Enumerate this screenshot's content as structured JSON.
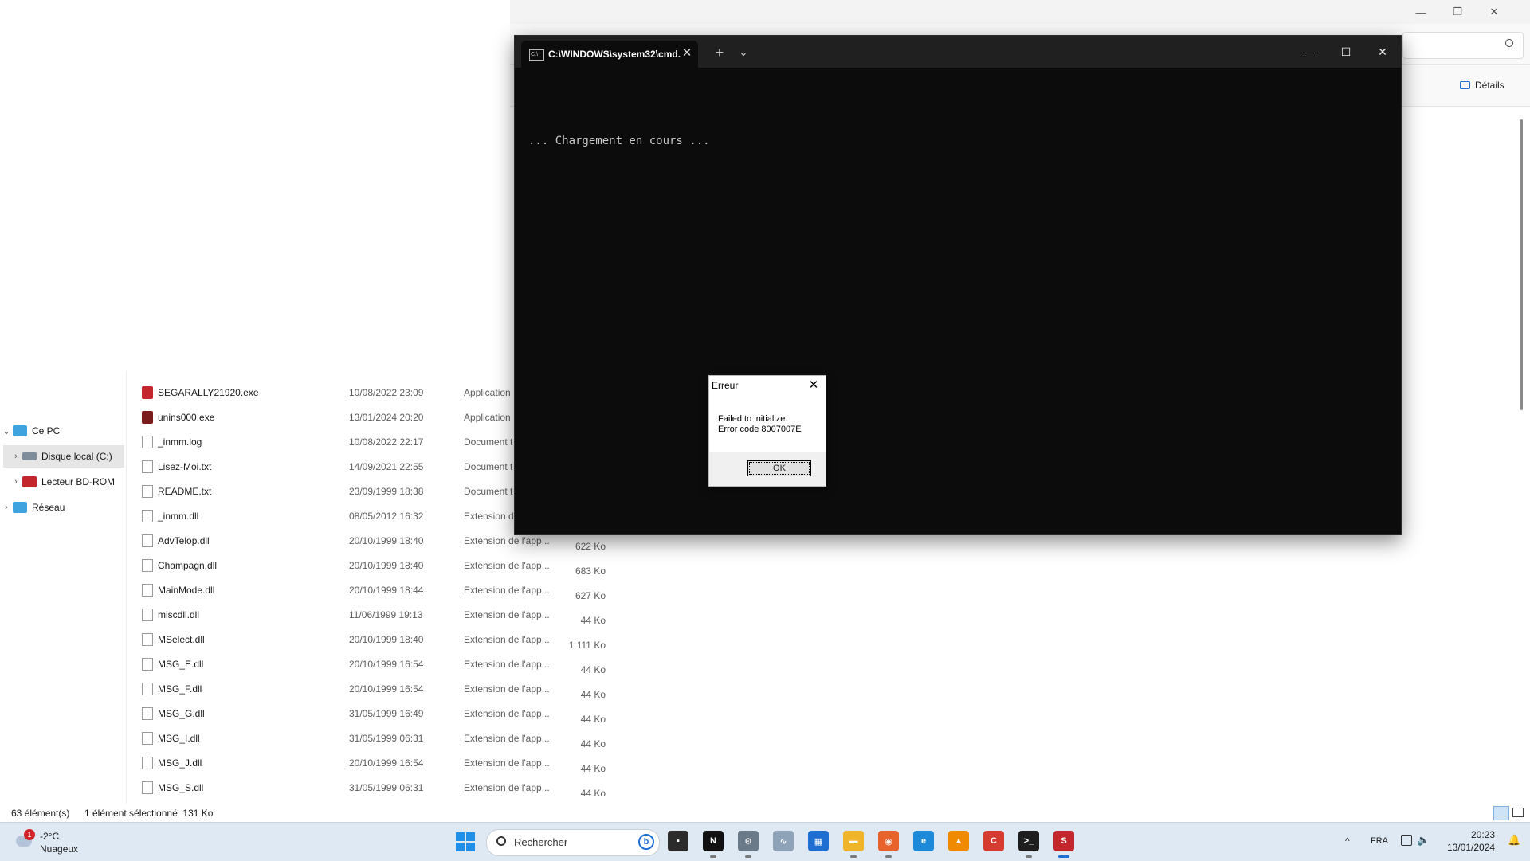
{
  "explorer": {
    "window_controls": {
      "minimize": "—",
      "restore": "❐",
      "close": "✕"
    },
    "details_label": "Détails",
    "nav": [
      {
        "label": "Ce PC",
        "expanded": true
      },
      {
        "label": "Disque local (C:)",
        "selected": true
      },
      {
        "label": "Lecteur BD-ROM"
      },
      {
        "label": "Réseau"
      }
    ],
    "files": [
      {
        "name": "SEGARALLY21920.exe",
        "date": "10/08/2022 23:09",
        "type": "Application",
        "size": "",
        "icon": "sega-exe-icon"
      },
      {
        "name": "unins000.exe",
        "date": "13/01/2024 20:20",
        "type": "Application",
        "size": "",
        "icon": "uninstall-exe-icon"
      },
      {
        "name": "_inmm.log",
        "date": "10/08/2022 22:17",
        "type": "Document t",
        "size": "",
        "icon": "text-file-icon"
      },
      {
        "name": "Lisez-Moi.txt",
        "date": "14/09/2021 22:55",
        "type": "Document t",
        "size": "",
        "icon": "text-file-icon"
      },
      {
        "name": "README.txt",
        "date": "23/09/1999 18:38",
        "type": "Document t",
        "size": "",
        "icon": "text-file-icon"
      },
      {
        "name": "_inmm.dll",
        "date": "08/05/2012 16:32",
        "type": "Extension de",
        "size": "",
        "icon": "dll-file-icon"
      },
      {
        "name": "AdvTelop.dll",
        "date": "20/10/1999 18:40",
        "type": "Extension de l'app...",
        "size": "622 Ko",
        "icon": "dll-file-icon"
      },
      {
        "name": "Champagn.dll",
        "date": "20/10/1999 18:40",
        "type": "Extension de l'app...",
        "size": "683 Ko",
        "icon": "dll-file-icon"
      },
      {
        "name": "MainMode.dll",
        "date": "20/10/1999 18:44",
        "type": "Extension de l'app...",
        "size": "627 Ko",
        "icon": "dll-file-icon"
      },
      {
        "name": "miscdll.dll",
        "date": "11/06/1999 19:13",
        "type": "Extension de l'app...",
        "size": "44 Ko",
        "icon": "dll-file-icon"
      },
      {
        "name": "MSelect.dll",
        "date": "20/10/1999 18:40",
        "type": "Extension de l'app...",
        "size": "1 111 Ko",
        "icon": "dll-file-icon"
      },
      {
        "name": "MSG_E.dll",
        "date": "20/10/1999 16:54",
        "type": "Extension de l'app...",
        "size": "44 Ko",
        "icon": "dll-file-icon"
      },
      {
        "name": "MSG_F.dll",
        "date": "20/10/1999 16:54",
        "type": "Extension de l'app...",
        "size": "44 Ko",
        "icon": "dll-file-icon"
      },
      {
        "name": "MSG_G.dll",
        "date": "31/05/1999 16:49",
        "type": "Extension de l'app...",
        "size": "44 Ko",
        "icon": "dll-file-icon"
      },
      {
        "name": "MSG_I.dll",
        "date": "31/05/1999 06:31",
        "type": "Extension de l'app...",
        "size": "44 Ko",
        "icon": "dll-file-icon"
      },
      {
        "name": "MSG_J.dll",
        "date": "20/10/1999 16:54",
        "type": "Extension de l'app...",
        "size": "44 Ko",
        "icon": "dll-file-icon"
      },
      {
        "name": "MSG_S.dll",
        "date": "31/05/1999 06:31",
        "type": "Extension de l'app...",
        "size": "44 Ko",
        "icon": "dll-file-icon"
      }
    ],
    "status": {
      "count": "63 élément(s)",
      "selection": "1 élément sélectionné  131 Ko"
    }
  },
  "terminal": {
    "tab_title": "C:\\WINDOWS\\system32\\cmd.",
    "tab_icon_text": "C:\\_",
    "new_tab": "+",
    "dropdown": "⌄",
    "controls": {
      "minimize": "—",
      "maximize": "☐",
      "close": "✕"
    },
    "output": "... Chargement en cours ..."
  },
  "dialog": {
    "title": "Erreur",
    "close": "✕",
    "line1": "Failed to initialize.",
    "line2": "Error code 8007007E",
    "ok": "OK"
  },
  "taskbar": {
    "weather": {
      "badge": "1",
      "temp": "-2°C",
      "desc": "Nuageux"
    },
    "search_placeholder": "Rechercher",
    "bing": "b",
    "apps": [
      {
        "name": "task-view",
        "color": "#2b2b2b",
        "glyph": "▪"
      },
      {
        "name": "nvidia",
        "color": "#111111",
        "glyph": "N",
        "running": true
      },
      {
        "name": "settings",
        "color": "#6b7a89",
        "glyph": "⚙",
        "running": true
      },
      {
        "name": "monitor",
        "color": "#8fa3b8",
        "glyph": "∿"
      },
      {
        "name": "store",
        "color": "#1f6fd2",
        "glyph": "▦"
      },
      {
        "name": "file-explorer",
        "color": "#f0b429",
        "glyph": "▬",
        "running": true
      },
      {
        "name": "firefox",
        "color": "#e8632b",
        "glyph": "◉",
        "running": true
      },
      {
        "name": "edge",
        "color": "#1c8ad9",
        "glyph": "e"
      },
      {
        "name": "vlc",
        "color": "#f08a00",
        "glyph": "▲"
      },
      {
        "name": "ccleaner",
        "color": "#d63b2f",
        "glyph": "C"
      },
      {
        "name": "terminal",
        "color": "#1e1e1e",
        "glyph": ">_",
        "running": true
      },
      {
        "name": "sega-rally",
        "color": "#c4262e",
        "glyph": "S",
        "active": true
      }
    ],
    "tray": {
      "up": "^",
      "lang": "FRA",
      "volume": "🔈",
      "bell": "🔔",
      "time": "20:23",
      "date": "13/01/2024"
    }
  }
}
